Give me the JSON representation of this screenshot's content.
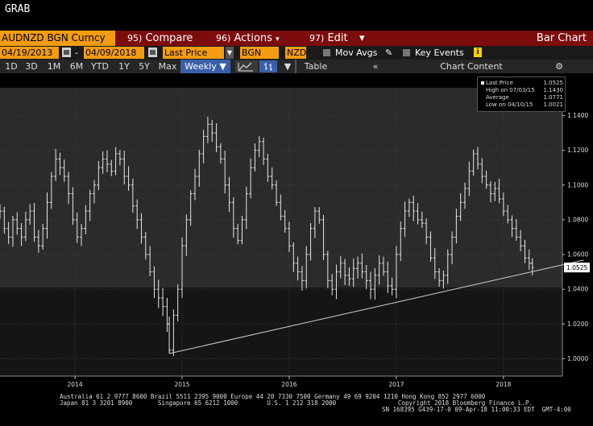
{
  "window": {
    "title": "GRAB"
  },
  "toolbar1": {
    "ticker": "AUDNZD BGN Curncy",
    "compare_num": "95)",
    "compare_label": "Compare",
    "actions_num": "96)",
    "actions_label": "Actions",
    "edit_num": "97)",
    "edit_label": "Edit",
    "chart_type": "Bar Chart"
  },
  "toolbar2": {
    "start_date": "04/19/2013",
    "end_date": "04/09/2018",
    "price_field": "Last Price",
    "source": "BGN",
    "currency": "NZD",
    "mov_avgs": "Mov Avgs",
    "key_events": "Key Events"
  },
  "toolbar3": {
    "periods": [
      "1D",
      "3D",
      "1M",
      "6M",
      "YTD",
      "1Y",
      "5Y",
      "Max"
    ],
    "frequency": "Weekly",
    "table_label": "Table",
    "chart_content": "Chart Content"
  },
  "legend": {
    "rows": [
      {
        "label": "Last Price",
        "value": "1.0525"
      },
      {
        "label": "High on 07/03/15",
        "value": "1.1430"
      },
      {
        "label": "Average",
        "value": "1.0771"
      },
      {
        "label": "Low on 04/10/15",
        "value": "1.0021"
      }
    ]
  },
  "colors": {
    "accent": "#f39c12",
    "toolbar_red": "#7d0c0c",
    "active_blue": "#3a5fa8"
  },
  "chart_data": {
    "type": "bar",
    "subtype": "ohlc",
    "frequency": "weekly",
    "series": [
      {
        "name": "Last Price",
        "values": [
          [
            2013.3,
            1.085
          ],
          [
            2013.34,
            1.075
          ],
          [
            2013.38,
            1.07
          ],
          [
            2013.42,
            1.08
          ],
          [
            2013.46,
            1.075
          ],
          [
            2013.5,
            1.07
          ],
          [
            2013.54,
            1.08
          ],
          [
            2013.58,
            1.085
          ],
          [
            2013.62,
            1.07
          ],
          [
            2013.66,
            1.065
          ],
          [
            2013.7,
            1.075
          ],
          [
            2013.74,
            1.09
          ],
          [
            2013.78,
            1.105
          ],
          [
            2013.82,
            1.115
          ],
          [
            2013.86,
            1.11
          ],
          [
            2013.9,
            1.105
          ],
          [
            2013.94,
            1.095
          ],
          [
            2013.98,
            1.08
          ],
          [
            2014.02,
            1.07
          ],
          [
            2014.06,
            1.075
          ],
          [
            2014.1,
            1.085
          ],
          [
            2014.14,
            1.095
          ],
          [
            2014.18,
            1.1
          ],
          [
            2014.22,
            1.11
          ],
          [
            2014.26,
            1.115
          ],
          [
            2014.3,
            1.112
          ],
          [
            2014.34,
            1.108
          ],
          [
            2014.38,
            1.118
          ],
          [
            2014.42,
            1.115
          ],
          [
            2014.46,
            1.105
          ],
          [
            2014.5,
            1.1
          ],
          [
            2014.54,
            1.088
          ],
          [
            2014.58,
            1.08
          ],
          [
            2014.62,
            1.07
          ],
          [
            2014.66,
            1.06
          ],
          [
            2014.7,
            1.05
          ],
          [
            2014.74,
            1.04
          ],
          [
            2014.78,
            1.035
          ],
          [
            2014.82,
            1.03
          ],
          [
            2014.86,
            1.02
          ],
          [
            2014.88,
            1.005
          ],
          [
            2014.92,
            1.025
          ],
          [
            2014.96,
            1.04
          ],
          [
            2015.0,
            1.065
          ],
          [
            2015.04,
            1.08
          ],
          [
            2015.08,
            1.095
          ],
          [
            2015.12,
            1.105
          ],
          [
            2015.16,
            1.118
          ],
          [
            2015.2,
            1.128
          ],
          [
            2015.24,
            1.135
          ],
          [
            2015.28,
            1.13
          ],
          [
            2015.32,
            1.122
          ],
          [
            2015.36,
            1.115
          ],
          [
            2015.4,
            1.1
          ],
          [
            2015.44,
            1.09
          ],
          [
            2015.48,
            1.075
          ],
          [
            2015.52,
            1.068
          ],
          [
            2015.56,
            1.08
          ],
          [
            2015.6,
            1.095
          ],
          [
            2015.64,
            1.11
          ],
          [
            2015.68,
            1.12
          ],
          [
            2015.72,
            1.125
          ],
          [
            2015.76,
            1.115
          ],
          [
            2015.8,
            1.105
          ],
          [
            2015.84,
            1.1
          ],
          [
            2015.88,
            1.09
          ],
          [
            2015.92,
            1.082
          ],
          [
            2015.96,
            1.075
          ],
          [
            2016.0,
            1.065
          ],
          [
            2016.04,
            1.055
          ],
          [
            2016.08,
            1.05
          ],
          [
            2016.12,
            1.045
          ],
          [
            2016.16,
            1.06
          ],
          [
            2016.2,
            1.075
          ],
          [
            2016.24,
            1.085
          ],
          [
            2016.28,
            1.08
          ],
          [
            2016.32,
            1.06
          ],
          [
            2016.36,
            1.045
          ],
          [
            2016.4,
            1.04
          ],
          [
            2016.44,
            1.05
          ],
          [
            2016.48,
            1.055
          ],
          [
            2016.52,
            1.048
          ],
          [
            2016.56,
            1.046
          ],
          [
            2016.6,
            1.052
          ],
          [
            2016.64,
            1.055
          ],
          [
            2016.68,
            1.05
          ],
          [
            2016.72,
            1.045
          ],
          [
            2016.76,
            1.04
          ],
          [
            2016.8,
            1.048
          ],
          [
            2016.84,
            1.055
          ],
          [
            2016.88,
            1.05
          ],
          [
            2016.92,
            1.042
          ],
          [
            2016.96,
            1.04
          ],
          [
            2017.0,
            1.06
          ],
          [
            2017.04,
            1.075
          ],
          [
            2017.08,
            1.085
          ],
          [
            2017.12,
            1.09
          ],
          [
            2017.16,
            1.085
          ],
          [
            2017.2,
            1.08
          ],
          [
            2017.24,
            1.078
          ],
          [
            2017.28,
            1.07
          ],
          [
            2017.32,
            1.058
          ],
          [
            2017.36,
            1.05
          ],
          [
            2017.4,
            1.045
          ],
          [
            2017.44,
            1.048
          ],
          [
            2017.48,
            1.06
          ],
          [
            2017.52,
            1.07
          ],
          [
            2017.56,
            1.082
          ],
          [
            2017.6,
            1.09
          ],
          [
            2017.64,
            1.098
          ],
          [
            2017.68,
            1.108
          ],
          [
            2017.72,
            1.118
          ],
          [
            2017.76,
            1.112
          ],
          [
            2017.8,
            1.105
          ],
          [
            2017.84,
            1.1
          ],
          [
            2017.88,
            1.095
          ],
          [
            2017.92,
            1.098
          ],
          [
            2017.96,
            1.092
          ],
          [
            2018.0,
            1.085
          ],
          [
            2018.04,
            1.08
          ],
          [
            2018.08,
            1.075
          ],
          [
            2018.12,
            1.07
          ],
          [
            2018.16,
            1.065
          ],
          [
            2018.2,
            1.058
          ],
          [
            2018.24,
            1.055
          ],
          [
            2018.27,
            1.0525
          ]
        ]
      }
    ],
    "trendline": {
      "x": [
        2014.88,
        2019.05
      ],
      "y": [
        1.003,
        1.061
      ]
    },
    "last_price_label": "1.0525",
    "x_ticks": [
      "2014",
      "2015",
      "2016",
      "2017",
      "2018"
    ],
    "x_tick_values": [
      2014,
      2015,
      2016,
      2017,
      2018
    ],
    "y_ticks": [
      "1.0000",
      "1.0200",
      "1.0400",
      "1.0600",
      "1.0800",
      "1.1000",
      "1.1200",
      "1.1400"
    ],
    "y_tick_values": [
      1.0,
      1.02,
      1.04,
      1.06,
      1.08,
      1.1,
      1.12,
      1.14
    ],
    "xlim": [
      2013.3,
      2018.55
    ],
    "ylim": [
      0.99,
      1.156
    ],
    "grid": true,
    "legend_position": "top-right"
  },
  "footer": {
    "line1": "Australia 61 2 9777 8600 Brazil 5511 2395 9000 Europe 44 20 7330 7500 Germany 49 69 9204 1210 Hong Kong 852 2977 6000",
    "line2": "Japan 81 3 3201 8900       Singapore 65 6212 1000        U.S. 1 212 318 2000                 Copyright 2018 Bloomberg Finance L.P.",
    "line3": "SN 168395 G439-17-0 09-Apr-18 11:00:33 EDT  GMT-4:00"
  }
}
